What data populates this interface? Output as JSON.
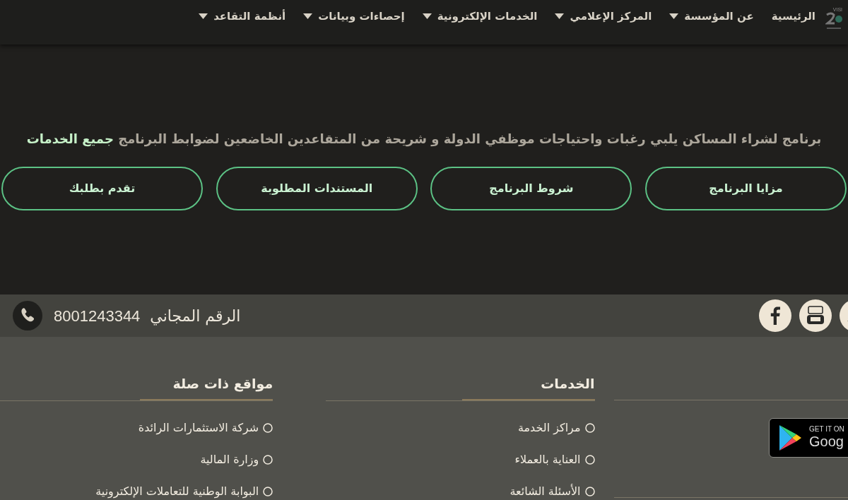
{
  "header": {
    "logo_text": "VISI",
    "nav": [
      {
        "label": "الرئيسية",
        "dropdown": false
      },
      {
        "label": "عن المؤسسة",
        "dropdown": true
      },
      {
        "label": "المركز الإعلامي",
        "dropdown": true
      },
      {
        "label": "الخدمات الإلكترونية",
        "dropdown": true
      },
      {
        "label": "إحصاءات وبيانات",
        "dropdown": true
      },
      {
        "label": "أنظمة التقاعد",
        "dropdown": true
      }
    ]
  },
  "hero": {
    "description": "برنامج لشراء المساكن يلبي رغبات واحتياجات موظفي الدولة و شريحة من المتقاعدين الخاضعين لضوابط البرنامج",
    "link": "جميع الخدمات",
    "buttons": [
      "مزايا البرنامج",
      "شروط البرنامج",
      "المستندات المطلوبة",
      "تقدم بطلبك"
    ]
  },
  "contact_bar": {
    "label": "الرقم المجاني",
    "phone": "8001243344"
  },
  "footer": {
    "app_badge": {
      "line1": "GET IT ON",
      "line2": "Goog"
    },
    "columns": [
      {
        "title": "الخدمات",
        "links": [
          "مراكز الخدمة",
          "العناية بالعملاء",
          "الأسئلة الشائعة"
        ]
      },
      {
        "title": "مواقع ذات صلة",
        "links": [
          "شركة الاستثمارات الرائدة",
          "وزارة المالية",
          "البوابة الوطنية للتعاملات الإلكترونية"
        ]
      }
    ]
  }
}
